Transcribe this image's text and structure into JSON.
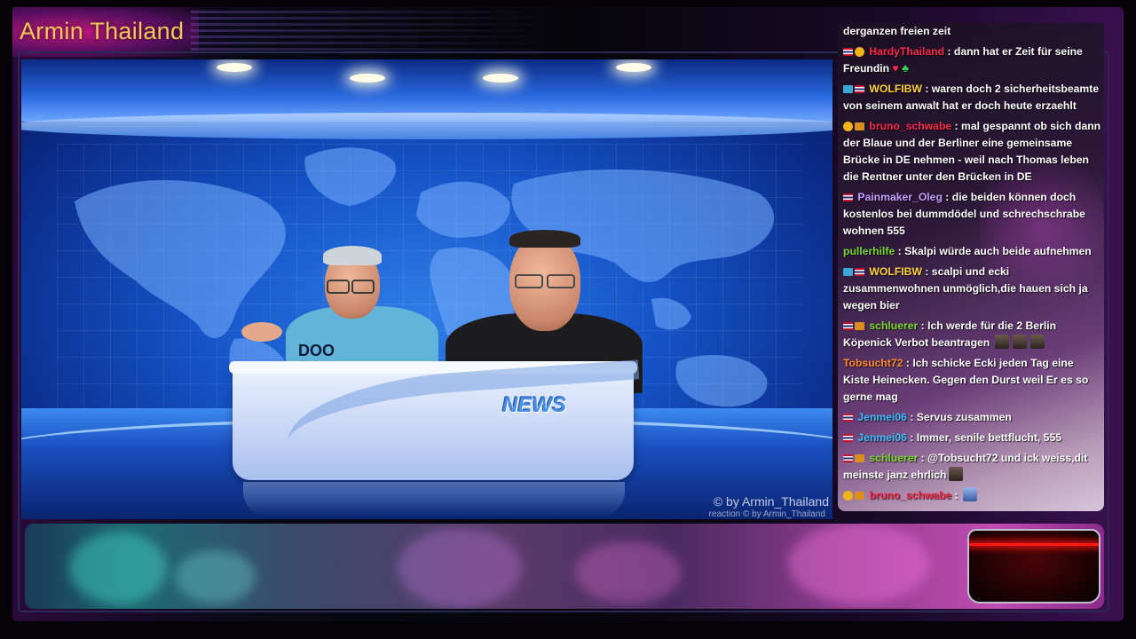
{
  "channel": {
    "title": "Armin Thailand"
  },
  "studio": {
    "desk_label": "NEWS",
    "shirt_text": "DOO YORK",
    "watermark": "© by Armin_Thailand",
    "watermark_small": "reaction  © by Armin_Thailand"
  },
  "chat": {
    "colors": {
      "red": "#ff2a4a",
      "blue": "#6b7cff",
      "violet": "#c79cff",
      "green": "#56e06b",
      "orange": "#ff8a2a",
      "cyan": "#3fbfff",
      "lime": "#7ad92a"
    },
    "messages": [
      {
        "user": "",
        "text": "derganzen freien zeit"
      },
      {
        "user": "HardyThailand",
        "text": " : dann hat er Zeit für seine Freundin "
      },
      {
        "user": "WOLFIBW",
        "text": " : waren doch 2 sicherheitsbeamte von seinem anwalt hat er doch heute erzaehlt"
      },
      {
        "user": "bruno_schwabe",
        "text": " : mal gespannt ob sich dann der Blaue und der Berliner eine gemeinsame Brücke in DE nehmen - weil nach Thomas leben die Rentner unter den Brücken in DE"
      },
      {
        "user": "Painmaker_Oleg",
        "text": " : die beiden können doch kostenlos bei dummdödel und schrechschrabe wohnen 555"
      },
      {
        "user": "pullerhilfe",
        "text": " : Skalpi würde auch beide aufnehmen"
      },
      {
        "user": "WOLFIBW",
        "text": " : scalpi und ecki zusammenwohnen unmöglich,die hauen sich ja wegen bier"
      },
      {
        "user": "schluerer",
        "text": " : Ich werde für die 2 Berlin Köpenick Verbot beantragen"
      },
      {
        "user": "Tobsucht72",
        "text": " : Ich schicke Ecki jeden Tag eine Kiste Heinecken. Gegen den Durst weil Er es so gerne mag"
      },
      {
        "user": "Jenmei06",
        "text": " : Servus zusammen"
      },
      {
        "user": "Jenmei06",
        "text": " : Immer, senile bettflucht, 555"
      },
      {
        "user": "schluerer",
        "text": " : @Tobsucht72 und ick weiss,dit meinste janz ehrlich"
      },
      {
        "user": "bruno_schwabe",
        "text": " : "
      }
    ]
  }
}
